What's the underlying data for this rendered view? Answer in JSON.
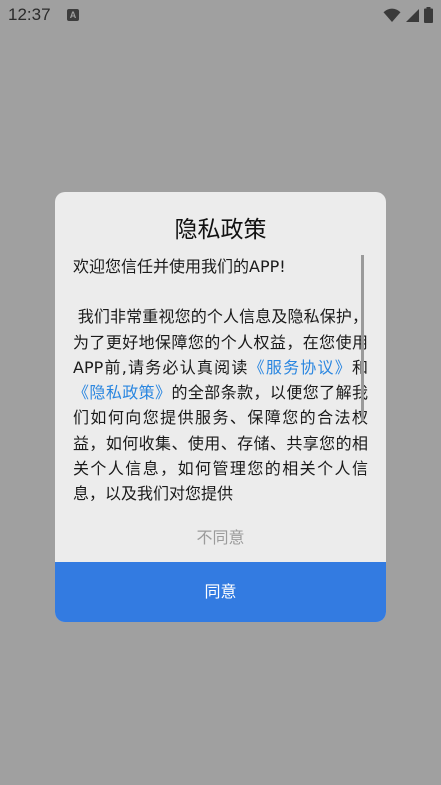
{
  "status_bar": {
    "time": "12:37",
    "notification_icon_letter": "A",
    "icons": [
      "wifi-icon",
      "cellular-signal-icon",
      "battery-icon"
    ]
  },
  "dialog": {
    "title": "隐私政策",
    "greeting": "欢迎您信任并使用我们的APP!",
    "body_before": "我们非常重视您的个人信息及隐私保护，为了更好地保障您的个人权益，在您使用APP前,请务必认真阅读",
    "link_service": "《服务协议》",
    "connector": "和",
    "link_privacy": "《隐私政策》",
    "body_after": "的全部条款，以便您了解我们如何向您提供服务、保障您的合法权益，如何收集、使用、存储、共享您的相关个人信息，如何管理您的相关个人信息，以及我们对您提供",
    "disagree_label": "不同意",
    "agree_label": "同意"
  },
  "colors": {
    "overlay": "#a0a0a0",
    "dialog_bg": "#ececec",
    "link": "#2a86e0",
    "agree_button": "#337be1",
    "disagree_text": "#9b9b9b"
  }
}
